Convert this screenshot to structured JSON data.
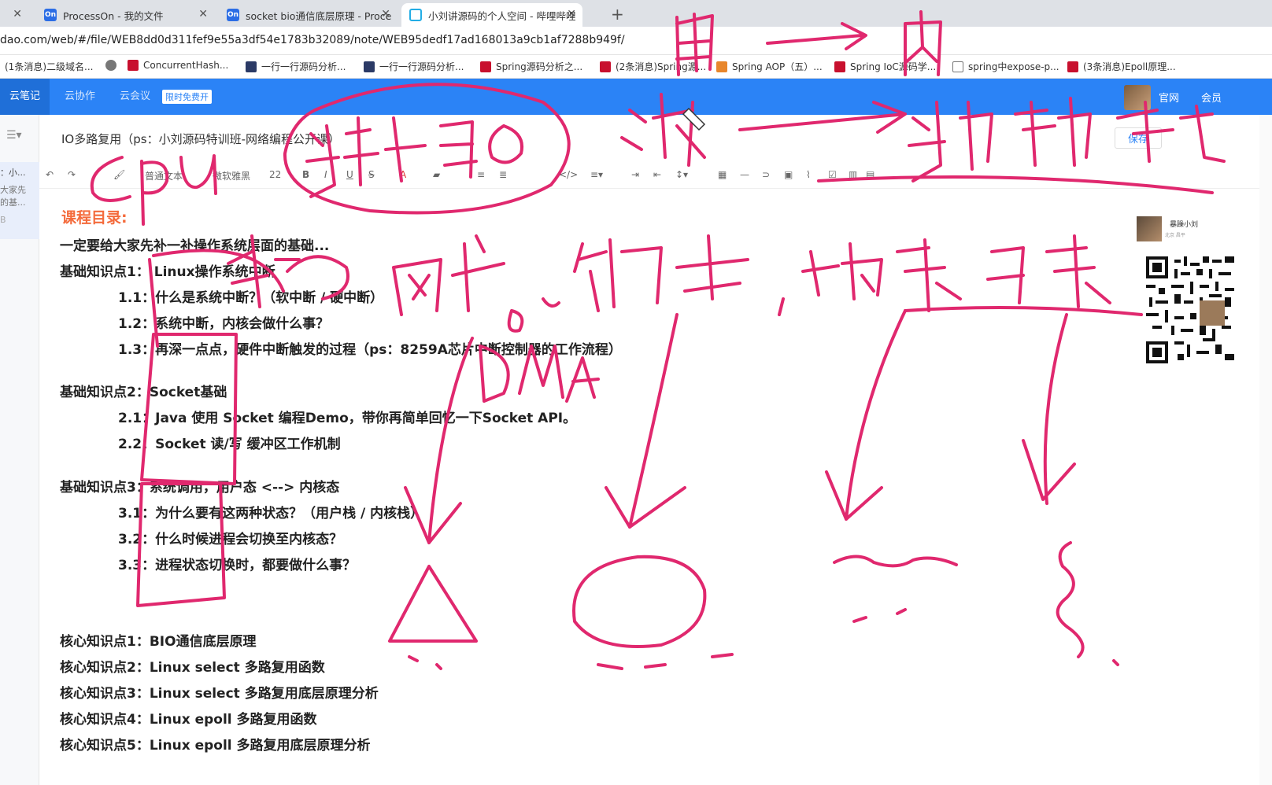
{
  "browser": {
    "tabs": [
      {
        "title": "ProcessOn - 我的文件",
        "icon_text": "On",
        "icon_color": "#2b6de5"
      },
      {
        "title": "socket bio通信底层原理 - Proce",
        "icon_text": "On",
        "icon_color": "#2b6de5"
      },
      {
        "title": "小刘讲源码的个人空间 - 哔哩哔哩",
        "icon_text": "",
        "icon_color": "#23ade5"
      }
    ],
    "new_tab": "+",
    "close_glyph": "✕",
    "url": "dao.com/web/#/file/WEB8dd0d311fef9e55a3df54e1783b32089/note/WEB95dedf17ad168013a9cb1af7288b949f/"
  },
  "bookmarks": [
    {
      "label": "(1条消息)二级域名...",
      "color": "#999"
    },
    {
      "label": "ConcurrentHash...",
      "color": "#c8102e"
    },
    {
      "label": "一行一行源码分析...",
      "color": "#2b3a66"
    },
    {
      "label": "一行一行源码分析...",
      "color": "#2b3a66"
    },
    {
      "label": "Spring源码分析之...",
      "color": "#c8102e"
    },
    {
      "label": "(2条消息)Spring源...",
      "color": "#c8102e"
    },
    {
      "label": "Spring AOP（五）...",
      "color": "#e8862b"
    },
    {
      "label": "Spring IoC源码学...",
      "color": "#c8102e"
    },
    {
      "label": "spring中expose-p...",
      "color": "#555"
    },
    {
      "label": "(3条消息)Epoll原理...",
      "color": "#c8102e"
    }
  ],
  "app": {
    "tabs": [
      "云笔记",
      "云协作",
      "云会议"
    ],
    "promo": "限时免费开",
    "right_links": [
      "官网",
      "会员"
    ],
    "doc_title": "IO多路复用（ps：小刘源码特训班-网络编程公开课）",
    "save_label": "保存"
  },
  "sidebar": {
    "card_lines": [
      "：小...",
      "大家先",
      "的基...",
      "B"
    ]
  },
  "toolbar": {
    "style_select": "普通文本",
    "font_select": "微软雅黑",
    "size_select": "22",
    "bold": "B",
    "italic": "I",
    "underline": "U",
    "strike": "S",
    "code": "</>"
  },
  "content": {
    "heading": "课程目录:",
    "lines": [
      "一定要给大家先补一补操作系统层面的基础...",
      "基础知识点1：  Linux操作系统中断",
      "1.1：什么是系统中断？（软中断 / 硬中断）",
      "1.2：系统中断，内核会做什么事？",
      "1.3：再深一点点，硬件中断触发的过程（ps：8259A芯片中断控制器的工作流程）",
      "基础知识点2：Socket基础",
      "2.1：Java 使用 Socket 编程Demo，带你再简单回忆一下Socket API。",
      "2.2：Socket 读/写 缓冲区工作机制",
      "基础知识点3：系统调用，用户态 <--> 内核态",
      "3.1：为什么要有这两种状态？（用户栈 / 内核栈）",
      "3.2：什么时候进程会切换至内核态？",
      "3.3：进程状态切换时，都要做什么事？",
      "核心知识点1：BIO通信底层原理",
      "核心知识点2：Linux select 多路复用函数",
      "核心知识点3：Linux select 多路复用底层原理分析",
      "核心知识点4：Linux epoll 多路复用函数",
      "核心知识点5：Linux epoll 多路复用底层原理分析"
    ]
  },
  "author": {
    "name": "暴躁小刘",
    "location": "北京 昌平"
  },
  "annotation": {
    "color": "#e0286e"
  }
}
